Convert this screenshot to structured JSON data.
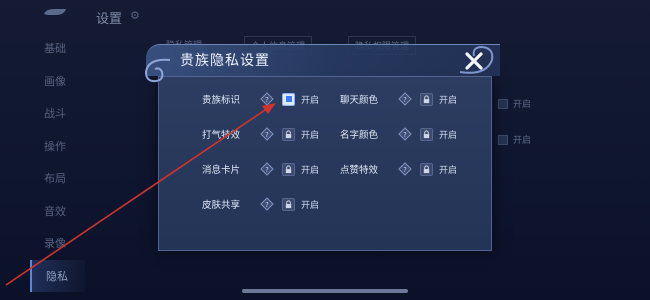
{
  "colors": {
    "accent": "#3b7bff",
    "annotation_arrow": "#d0342c",
    "modal_bg": "#2c3d61"
  },
  "background": {
    "title": "设置",
    "back_icon": "back-arrow-icon",
    "subtabs": [
      "隐私管理",
      "个人信息管理",
      "隐私权限管理"
    ],
    "sidebar": [
      "基础",
      "画像",
      "战斗",
      "操作",
      "布局",
      "音效",
      "录像",
      "隐私"
    ],
    "active_sidebar": "隐私",
    "right_toggles": [
      "开启",
      "开启"
    ]
  },
  "modal": {
    "title": "贵族隐私设置",
    "close_icon": "close-icon",
    "help_icon": "question-diamond-icon",
    "lock_icon": "lock-icon",
    "settings": [
      {
        "label": "贵族标识",
        "state": "checked",
        "option": "开启"
      },
      {
        "label": "聊天颜色",
        "state": "locked",
        "option": "开启"
      },
      {
        "label": "打气特效",
        "state": "locked",
        "option": "开启"
      },
      {
        "label": "名字颜色",
        "state": "locked",
        "option": "开启"
      },
      {
        "label": "消息卡片",
        "state": "locked",
        "option": "开启"
      },
      {
        "label": "点赞特效",
        "state": "locked",
        "option": "开启"
      },
      {
        "label": "皮肤共享",
        "state": "locked",
        "option": "开启"
      }
    ]
  }
}
